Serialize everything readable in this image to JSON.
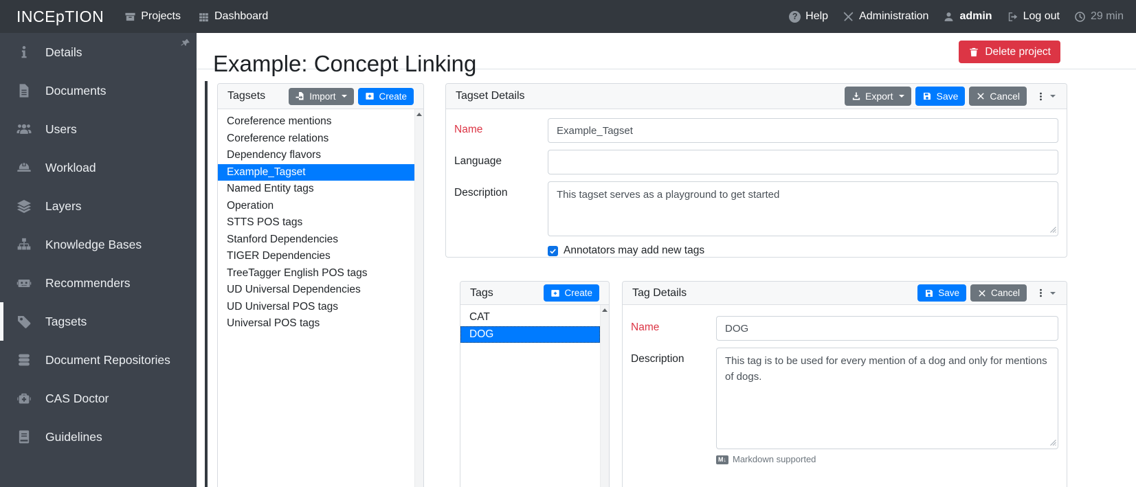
{
  "navbar": {
    "brand": "INCEpTION",
    "left_items": [
      {
        "label": "Projects",
        "icon": "archive-icon"
      },
      {
        "label": "Dashboard",
        "icon": "grid-icon"
      }
    ],
    "right_items": [
      {
        "label": "Help",
        "icon": "help-icon"
      },
      {
        "label": "Administration",
        "icon": "tools-icon"
      },
      {
        "label": "admin",
        "icon": "user-icon",
        "bold": true
      },
      {
        "label": "Log out",
        "icon": "logout-icon"
      },
      {
        "label": "29 min",
        "icon": "clock-icon",
        "muted": true,
        "interactable": false
      }
    ]
  },
  "sidebar": {
    "items": [
      {
        "label": "Details",
        "icon": "info-icon"
      },
      {
        "label": "Documents",
        "icon": "file-icon"
      },
      {
        "label": "Users",
        "icon": "users-icon"
      },
      {
        "label": "Workload",
        "icon": "hard-hat-icon"
      },
      {
        "label": "Layers",
        "icon": "layers-icon"
      },
      {
        "label": "Knowledge Bases",
        "icon": "sitemap-icon"
      },
      {
        "label": "Recommenders",
        "icon": "robot-icon"
      },
      {
        "label": "Tagsets",
        "icon": "tag-icon",
        "active": true
      },
      {
        "label": "Document Repositories",
        "icon": "database-icon"
      },
      {
        "label": "CAS Doctor",
        "icon": "first-aid-icon"
      },
      {
        "label": "Guidelines",
        "icon": "book-icon"
      }
    ]
  },
  "header": {
    "title": "Example: Concept Linking",
    "delete_button": "Delete project"
  },
  "tagsets_panel": {
    "title": "Tagsets",
    "import_button": "Import",
    "create_button": "Create",
    "selected": "Example_Tagset",
    "items": [
      "Coreference mentions",
      "Coreference relations",
      "Dependency flavors",
      "Example_Tagset",
      "Named Entity tags",
      "Operation",
      "STTS POS tags",
      "Stanford Dependencies",
      "TIGER Dependencies",
      "TreeTagger English POS tags",
      "UD Universal Dependencies",
      "UD Universal POS tags",
      "Universal POS tags"
    ]
  },
  "tagset_details": {
    "title": "Tagset Details",
    "export_button": "Export",
    "save_button": "Save",
    "cancel_button": "Cancel",
    "name_label": "Name",
    "name_value": "Example_Tagset",
    "language_label": "Language",
    "language_value": "",
    "description_label": "Description",
    "description_value": "This tagset serves as a playground to get started",
    "checkbox_label": "Annotators may add new tags",
    "checkbox_checked": true
  },
  "tags_panel": {
    "title": "Tags",
    "create_button": "Create",
    "selected": "DOG",
    "items": [
      "CAT",
      "DOG"
    ]
  },
  "tag_details": {
    "title": "Tag Details",
    "save_button": "Save",
    "cancel_button": "Cancel",
    "name_label": "Name",
    "name_value": "DOG",
    "description_label": "Description",
    "description_value": "This tag is to be used for every mention of a dog and only for mentions of dogs.",
    "markdown_note": "Markdown supported"
  },
  "colors": {
    "accent": "#007bff",
    "secondary": "#6c757d",
    "danger": "#dc3545",
    "navbar_bg": "#33383e",
    "sidebar_bg": "#3d434c",
    "selection_bg": "#007bff"
  }
}
